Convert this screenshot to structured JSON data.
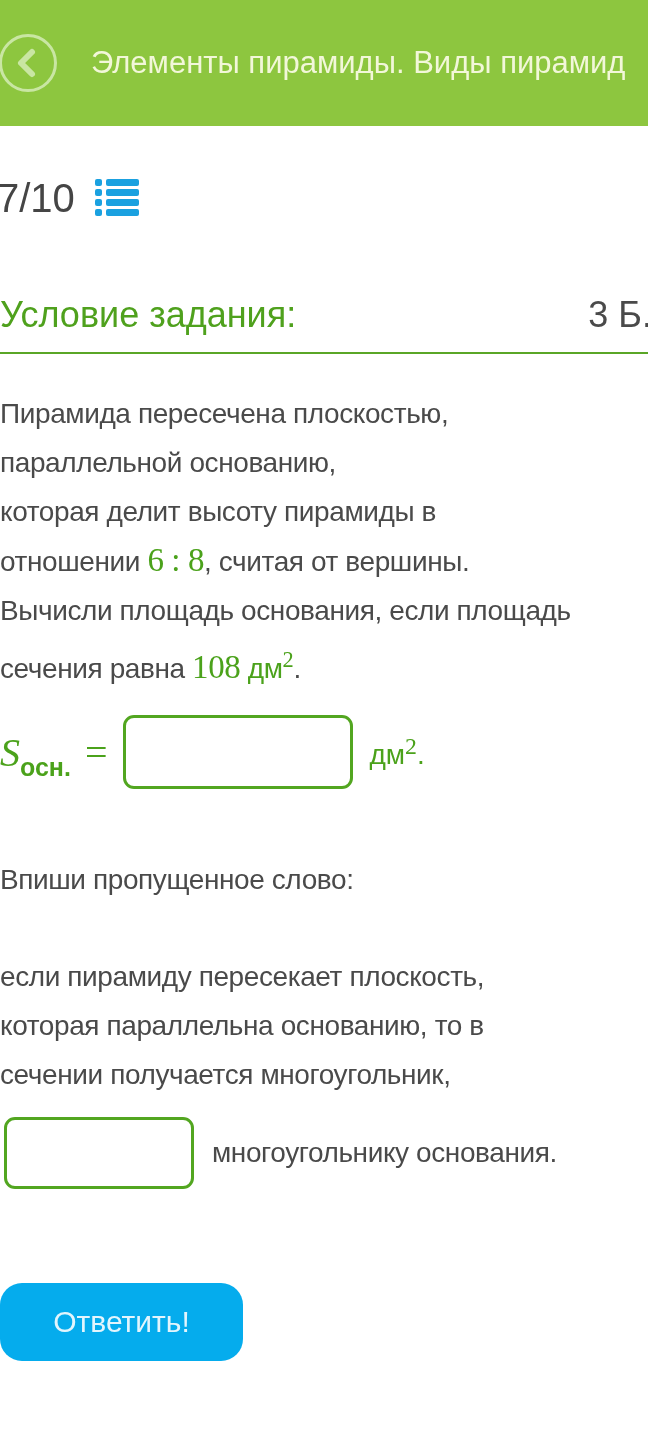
{
  "header": {
    "title": "Элементы пирамиды. Виды пирамид"
  },
  "progress": {
    "counter": "7/10"
  },
  "task": {
    "heading": "Условие задания:",
    "points": "3 Б."
  },
  "condition": {
    "lines": [
      {
        "segments": [
          {
            "kind": "text",
            "text": "Пирамида пересечена плоскостью,"
          }
        ]
      },
      {
        "segments": [
          {
            "kind": "text",
            "text": "параллельной основанию,"
          }
        ]
      },
      {
        "segments": [
          {
            "kind": "text",
            "text": "которая делит высоту пирамиды в"
          }
        ]
      },
      {
        "segments": [
          {
            "kind": "text",
            "text": "отношении "
          },
          {
            "kind": "number",
            "text": "6 : 8"
          },
          {
            "kind": "text",
            "text": ", считая от вершины."
          }
        ]
      },
      {
        "segments": [
          {
            "kind": "text",
            "text": "Вычисли площадь основания, если площадь"
          }
        ]
      },
      {
        "segments": [
          {
            "kind": "text",
            "text": "сечения равна "
          },
          {
            "kind": "number",
            "text": "108"
          },
          {
            "kind": "unit",
            "text": " дм$^{2}$"
          },
          {
            "kind": "text",
            "text": "."
          }
        ]
      }
    ]
  },
  "formula": {
    "variable": "S",
    "subscript": "осн.",
    "relation": "=",
    "unit": "дм$^{2}$."
  },
  "instruction": "Впиши пропущенное слово:",
  "fill_in": {
    "lines": [
      "если пирамиду пересекает плоскость,",
      "которая параллельна основанию, то в",
      "сечении получается многоугольник,"
    ],
    "after_blank": "многоугольнику основания."
  },
  "submit": {
    "label": "Ответить!"
  }
}
